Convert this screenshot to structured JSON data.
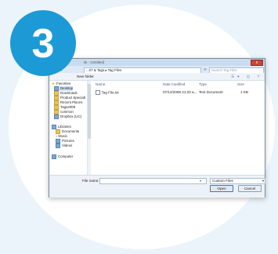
{
  "step": {
    "number": "3"
  },
  "dialog": {
    "title": "ile - (Untitled)",
    "close_label": "x",
    "breadcrumb": "...07 & Tags ▸ Tag Files",
    "search_placeholder": "Search Tag Files",
    "new_folder_label": "New folder",
    "toolbar_icons": "☰▾ ◫ ?"
  },
  "sidebar": {
    "favorites_label": "Favorites",
    "favorites": [
      "Desktop",
      "Downloads",
      "Product Specialt",
      "Recent Places",
      "Tags2008",
      "common",
      "Dropbox (UC)"
    ],
    "libraries_label": "Libraries",
    "libraries": [
      "Documents",
      "Music",
      "Pictures",
      "Videos"
    ],
    "computer_label": "Computer"
  },
  "columns": {
    "name": "Name",
    "date": "Date modified",
    "type": "Type",
    "size": "Size"
  },
  "files": [
    {
      "name": "Tag File.txt",
      "date": "07/12/2008 21:20 a...",
      "type": "Text Document",
      "size": "1 KB"
    }
  ],
  "footer": {
    "filename_label": "File name:",
    "filename_value": "",
    "filter_value": "Custom Files",
    "open_label": "Open",
    "cancel_label": "Cancel"
  },
  "colors": {
    "badge": "#1b9ad6",
    "background": "#ebf4fb"
  }
}
